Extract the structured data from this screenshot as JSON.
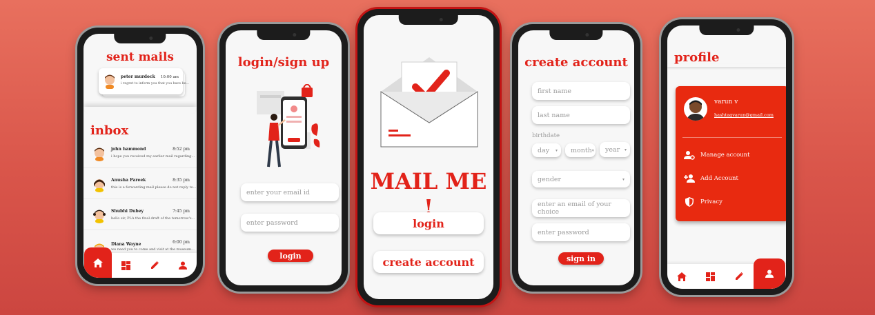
{
  "sent_phone": {
    "title": "sent mails",
    "sent_item": {
      "name": "peter murdock",
      "time": "10:00 am",
      "preview": "i regret to inform you that you have be..."
    },
    "inbox_title": "inbox",
    "inbox": [
      {
        "name": "john hammond",
        "time": "8:52 pm",
        "preview": "i hope you received my earlier mail regarding..."
      },
      {
        "name": "Anusha Pareek",
        "time": "8:35 pm",
        "preview": "this is a forwarding mail please do not reply to..."
      },
      {
        "name": "Shubhi Dubey",
        "time": "7:45 pm",
        "preview": "hello sir, PLA the final draft of the tomorrow's..."
      },
      {
        "name": "Diana Wayne",
        "time": "6:00 pm",
        "preview": "we need you to come and visit at the museum..."
      }
    ]
  },
  "login_phone": {
    "title": "login/sign up",
    "email_placeholder": "enter your email id",
    "password_placeholder": "enter password",
    "login_label": "login"
  },
  "home_phone": {
    "app_name": "MAIL ME !",
    "login_label": "login",
    "create_label": "create account"
  },
  "create_phone": {
    "title": "create account",
    "first_name": "first name",
    "last_name": "last name",
    "birthdate_label": "birthdate",
    "day": "day",
    "month": "month",
    "year": "year",
    "gender": "gender",
    "email": "enter an email of your choice",
    "password": "enter password",
    "signin_label": "sign in"
  },
  "profile_phone": {
    "title": "profile",
    "user_name": "varun v",
    "user_email": "hashtagvarun@gmail.com",
    "menu": [
      "Manage account",
      "Add Account",
      "Privacy"
    ]
  },
  "colors": {
    "accent": "#e2231a",
    "background": "#d9554a"
  }
}
